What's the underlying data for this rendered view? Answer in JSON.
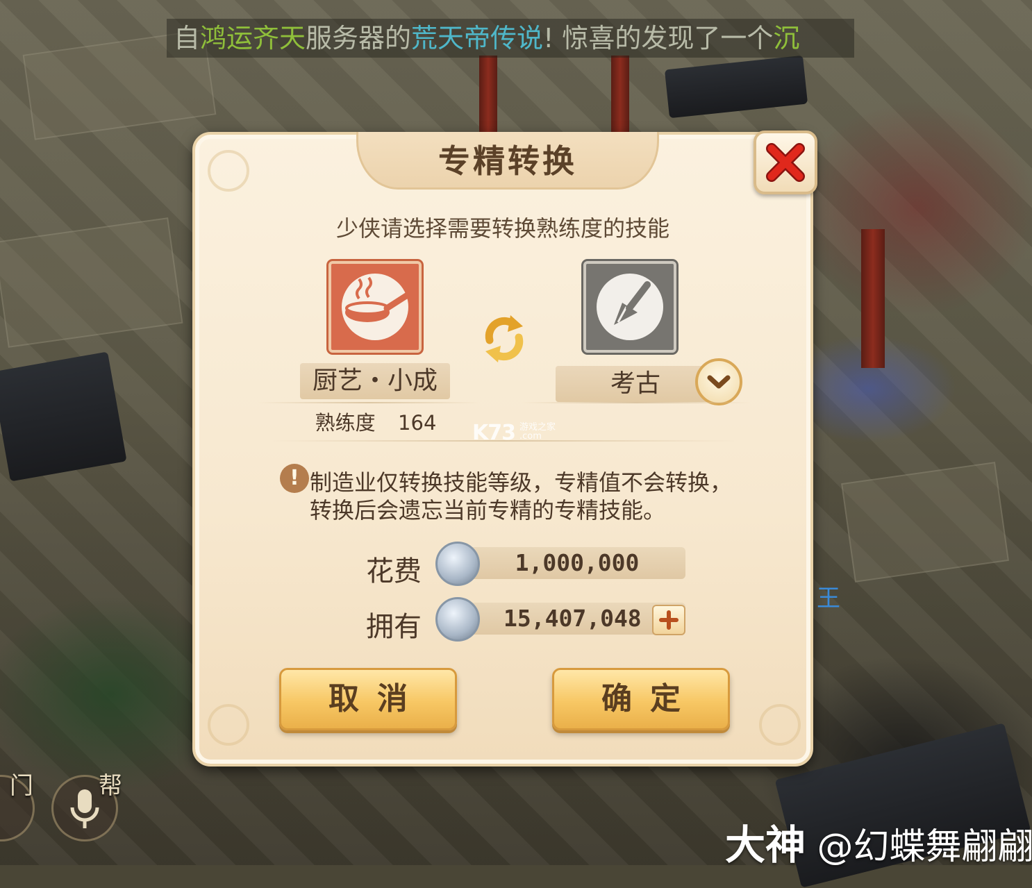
{
  "announcement": {
    "seg1": "自",
    "server": "鸿运齐天",
    "seg2": "服务器的",
    "player": "荒天帝传说",
    "seg3": "! 惊喜的发现了一个",
    "tail": "沉"
  },
  "dialog": {
    "title": "专精转换",
    "subtitle": "少侠请选择需要转换熟练度的技能",
    "from_skill": {
      "name": "厨艺・小成",
      "icon": "cooking-pan-icon",
      "proficiency_label": "熟练度",
      "proficiency_value": "164"
    },
    "to_skill": {
      "name": "考古",
      "icon": "shovel-icon"
    },
    "warning_line1": "制造业仅转换技能等级，专精值不会转换，",
    "warning_line2": "转换后会遗忘当前专精的专精技能。",
    "cost_label": "花费",
    "cost_value": "1,000,000",
    "owned_label": "拥有",
    "owned_value": "15,407,048",
    "cancel_label": "取消",
    "confirm_label": "确定"
  },
  "watermarks": {
    "site": "K73",
    "site_sub1": "游戏之家",
    "site_sub2": ".com",
    "credit_brand": "大神",
    "credit_user": "@幻蝶舞翩翩"
  },
  "side_ui": {
    "left_label": "门",
    "right_label": "帮",
    "npc_label": "王"
  },
  "colors": {
    "panel": "#f7e8cf",
    "button": "#f7c764",
    "close": "#d32a1f",
    "cooking_icon": "#d86b4c",
    "archaeology_icon": "#777570",
    "announce_green": "#8fbf3a",
    "announce_cyan": "#4fb7c9"
  }
}
